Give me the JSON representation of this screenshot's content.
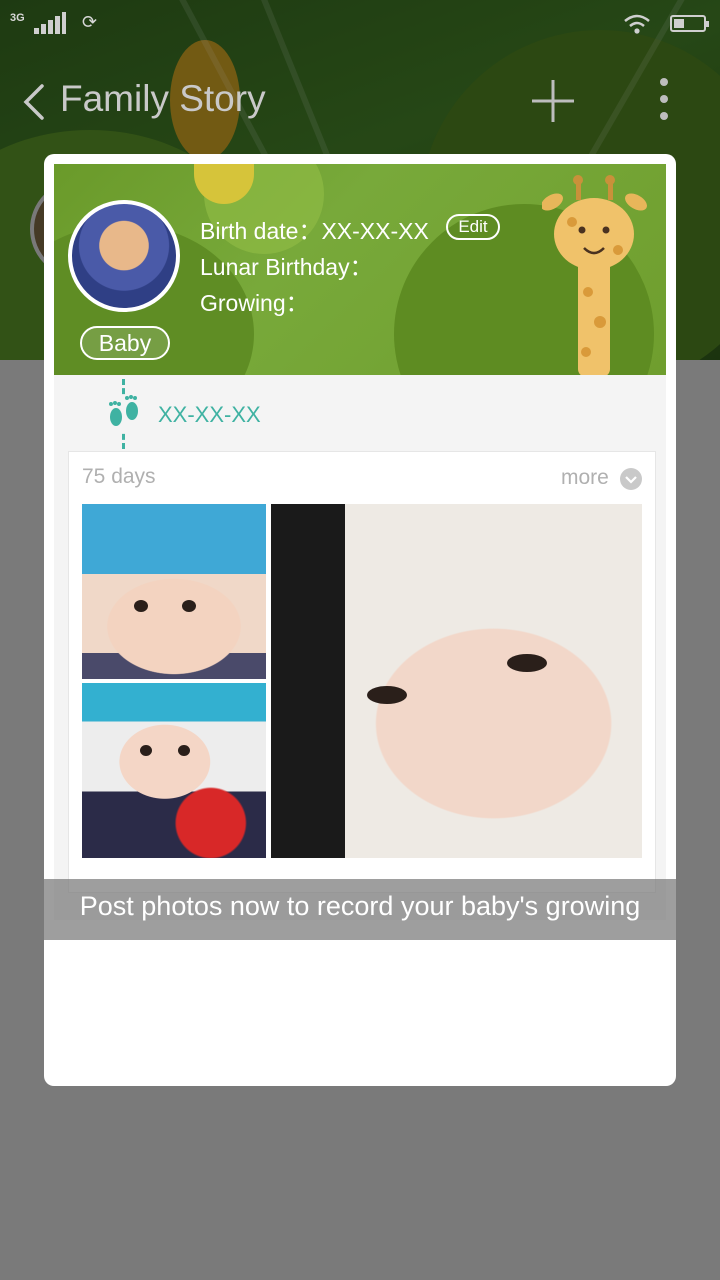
{
  "status_bar": {
    "network_type": "3G",
    "icons": [
      "call-icon",
      "signal-icon",
      "sync-icon",
      "wifi-icon",
      "battery-icon"
    ]
  },
  "app_bar": {
    "title": "Family Story",
    "icons": [
      "back-arrow-icon",
      "add-icon",
      "more-menu-icon"
    ]
  },
  "profile": {
    "name": "Baby",
    "birth_date_line": "Birth date：XX-XX-XX",
    "lunar_birthday_line": "Lunar Birthday：",
    "growing_line": "Growing：",
    "edit_label": "Edit"
  },
  "timeline": {
    "date": "XX-XX-XX",
    "icon": "footprints-icon"
  },
  "photo_card": {
    "days": "75 days",
    "more_label": "more",
    "photo_count": 3
  },
  "tutorial": {
    "caption": "Post photos now to record your baby's growing"
  },
  "colors": {
    "accent_teal": "#3fb2a2",
    "header_green": "#6f9e2e",
    "overlay_gray": "#7a7a7a",
    "text_gray": "#b0b0b0"
  }
}
